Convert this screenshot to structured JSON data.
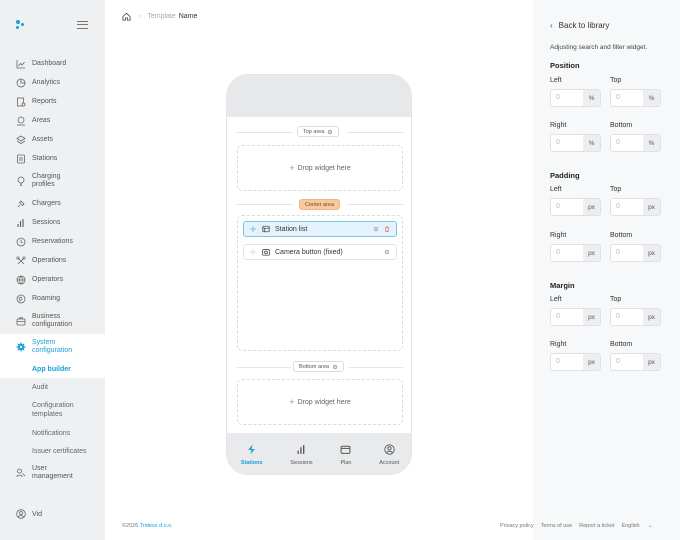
{
  "sidebar": {
    "items": [
      {
        "label": "Dashboard",
        "icon": "chart-icon"
      },
      {
        "label": "Analytics",
        "icon": "pie-chart-icon"
      },
      {
        "label": "Reports",
        "icon": "report-icon"
      },
      {
        "label": "Areas",
        "icon": "area-icon"
      },
      {
        "label": "Assets",
        "icon": "layers-icon"
      },
      {
        "label": "Stations",
        "icon": "station-icon"
      },
      {
        "label": "Charging profiles",
        "icon": "bulb-icon"
      },
      {
        "label": "Chargers",
        "icon": "plug-icon"
      },
      {
        "label": "Sessions",
        "icon": "bars-icon"
      },
      {
        "label": "Reservations",
        "icon": "clock-icon"
      },
      {
        "label": "Operations",
        "icon": "tools-icon"
      },
      {
        "label": "Operators",
        "icon": "globe-icon"
      },
      {
        "label": "Roaming",
        "icon": "roaming-icon"
      },
      {
        "label": "Business configuration",
        "icon": "briefcase-icon"
      },
      {
        "label": "System configuration",
        "icon": "gear-icon"
      }
    ],
    "subitems": [
      {
        "label": "App builder"
      },
      {
        "label": "Audit"
      },
      {
        "label": "Configuration templates"
      },
      {
        "label": "Notifications"
      },
      {
        "label": "Issuer certificates"
      }
    ],
    "user_management": "User management",
    "user_name": "Vid"
  },
  "breadcrumb": {
    "parent": "Template",
    "current": "Name"
  },
  "phone": {
    "top_area": "Top area",
    "center_area": "Center area",
    "bottom_area": "Bottom area",
    "drop_text": "Drop widget here",
    "widgets": [
      {
        "label": "Station list"
      },
      {
        "label": "Camera button (fixed)"
      }
    ],
    "tabs": [
      {
        "label": "Stations"
      },
      {
        "label": "Sessions"
      },
      {
        "label": "Plan"
      },
      {
        "label": "Account"
      }
    ]
  },
  "panel": {
    "back": "Back to library",
    "description": "Adjusting search and filter widget.",
    "sections": {
      "position": "Position",
      "padding": "Padding",
      "margin": "Margin"
    },
    "labels": {
      "left": "Left",
      "top": "Top",
      "right": "Right",
      "bottom": "Bottom"
    },
    "placeholder": "0",
    "unit_percent": "%",
    "unit_px": "px"
  },
  "footer": {
    "copyright": "©2026",
    "brand": "Tridess d.o.o.",
    "links": [
      "Privacy policy",
      "Terms of use",
      "Report a ticket",
      "English"
    ]
  },
  "colors": {
    "accent": "#1a9fd6",
    "center_badge": "#f6c9a1"
  }
}
